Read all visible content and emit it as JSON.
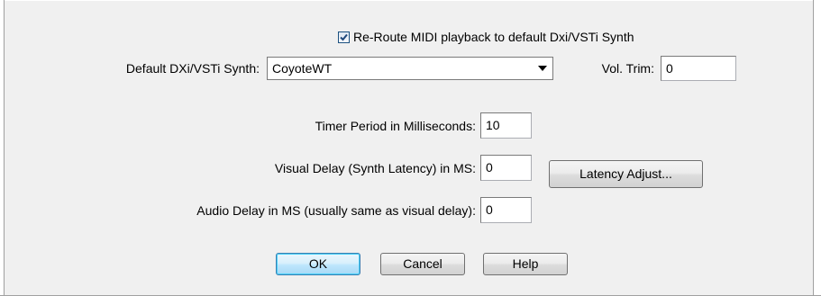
{
  "reroute": {
    "checked": true,
    "label": "Re-Route MIDI playback to default Dxi/VSTi Synth"
  },
  "synth": {
    "label": "Default DXi/VSTi Synth:",
    "value": "CoyoteWT"
  },
  "vol_trim": {
    "label": "Vol. Trim:",
    "value": "0"
  },
  "timer": {
    "label": "Timer Period in Milliseconds:",
    "value": "10"
  },
  "visual_delay": {
    "label": "Visual Delay (Synth Latency) in MS:",
    "value": "0"
  },
  "latency_button": {
    "label": "Latency Adjust..."
  },
  "audio_delay": {
    "label": "Audio Delay in MS (usually same as visual delay):",
    "value": "0"
  },
  "buttons": {
    "ok": "OK",
    "cancel": "Cancel",
    "help": "Help"
  },
  "icons": {
    "checkmark": "checkmark-icon",
    "dropdown": "chevron-down-icon"
  }
}
